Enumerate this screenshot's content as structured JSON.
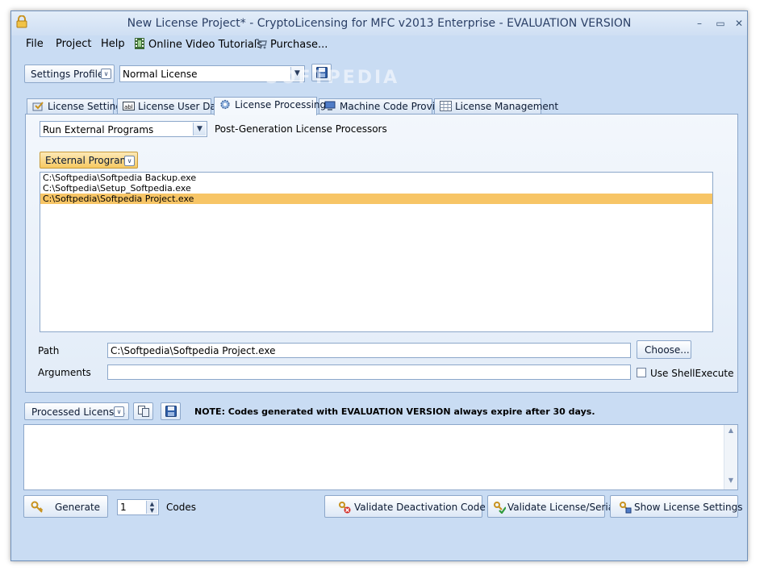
{
  "window": {
    "title": "New License Project* - CryptoLicensing for MFC v2013 Enterprise - EVALUATION VERSION",
    "controls": {
      "minimize": "–",
      "maximize": "▭",
      "close": "✕"
    }
  },
  "menu": {
    "items": [
      {
        "label": "File"
      },
      {
        "label": "Project"
      },
      {
        "label": "Help"
      },
      {
        "label": "Online Video Tutorials",
        "icon": "film-icon"
      },
      {
        "label": "Purchase...",
        "icon": "cart-icon"
      }
    ]
  },
  "profiles": {
    "button_label": "Settings Profiles",
    "selected": "Normal License"
  },
  "watermark": "SOFTPEDIA",
  "tabs": [
    {
      "label": "License Settings",
      "icon": "settings-icon",
      "active": false
    },
    {
      "label": "License User Data",
      "icon": "text-field-icon",
      "active": false
    },
    {
      "label": "License Processing",
      "icon": "gear-icon",
      "active": true
    },
    {
      "label": "Machine Code Provider",
      "icon": "computer-icon",
      "active": false
    },
    {
      "label": "License Management",
      "icon": "grid-icon",
      "active": false
    }
  ],
  "processing": {
    "processor_type": "Run External Programs",
    "processor_caption": "Post-Generation License Processors",
    "programs_button": "External Programs",
    "programs": [
      {
        "path": "C:\\Softpedia\\Softpedia Backup.exe",
        "selected": false
      },
      {
        "path": "C:\\Softpedia\\Setup_Softpedia.exe",
        "selected": false
      },
      {
        "path": "C:\\Softpedia\\Softpedia Project.exe",
        "selected": true
      }
    ],
    "path_label": "Path",
    "path_value": "C:\\Softpedia\\Softpedia Project.exe",
    "choose_button": "Choose...",
    "arguments_label": "Arguments",
    "arguments_value": "",
    "shell_execute_label": "Use ShellExecute",
    "shell_execute_checked": false
  },
  "processed": {
    "button_label": "Processed Licenses",
    "note": "NOTE: Codes generated with EVALUATION VERSION always expire after 30 days.",
    "output_text": ""
  },
  "footer": {
    "generate_label": "Generate",
    "codes_count": "1",
    "codes_label": "Codes",
    "validate_deactivation_label": "Validate Deactivation Code",
    "validate_license_label": "Validate License/Serial",
    "show_settings_label": "Show License Settings"
  },
  "colors": {
    "window_bg": "#c9dcf3",
    "selection": "#f7c566",
    "button_border": "#8ca7ca",
    "title_text": "#2a3f66"
  }
}
